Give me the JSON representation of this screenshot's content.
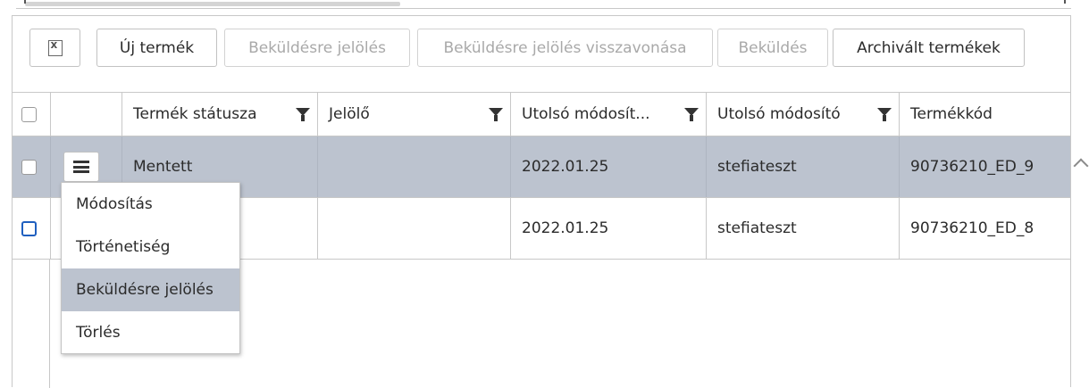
{
  "toolbar": {
    "export_icon": "excel-export-icon",
    "new_product": "Új termék",
    "mark_for_submission": "Beküldésre jelölés",
    "revoke_mark": "Beküldésre jelölés visszavonása",
    "submit": "Beküldés",
    "archived_products": "Archivált termékek"
  },
  "grid": {
    "columns": [
      {
        "label": "Termék státusza",
        "filter_icon": "filter-icon"
      },
      {
        "label": "Jelölő",
        "filter_icon": "filter-icon"
      },
      {
        "label": "Utolsó módosít...",
        "filter_icon": "filter-icon"
      },
      {
        "label": "Utolsó módosító",
        "filter_icon": "filter-icon"
      },
      {
        "label": "Termékkód"
      }
    ],
    "rows": [
      {
        "status": "Mentett",
        "marker": "",
        "modified": "2022.01.25",
        "modifier": "stefiateszt",
        "code": "90736210_ED_9",
        "selected": true
      },
      {
        "status": "",
        "marker": "",
        "modified": "2022.01.25",
        "modifier": "stefiateszt",
        "code": "90736210_ED_8",
        "selected": false
      }
    ]
  },
  "context_menu": {
    "items": [
      {
        "label": "Módosítás"
      },
      {
        "label": "Történetiség"
      },
      {
        "label": "Beküldésre jelölés",
        "highlighted": true
      },
      {
        "label": "Törlés"
      }
    ]
  },
  "colors": {
    "selected_row": "#bcc3cf",
    "checkbox_focus": "#1f5fbf",
    "disabled_text": "#a9a9a9"
  }
}
